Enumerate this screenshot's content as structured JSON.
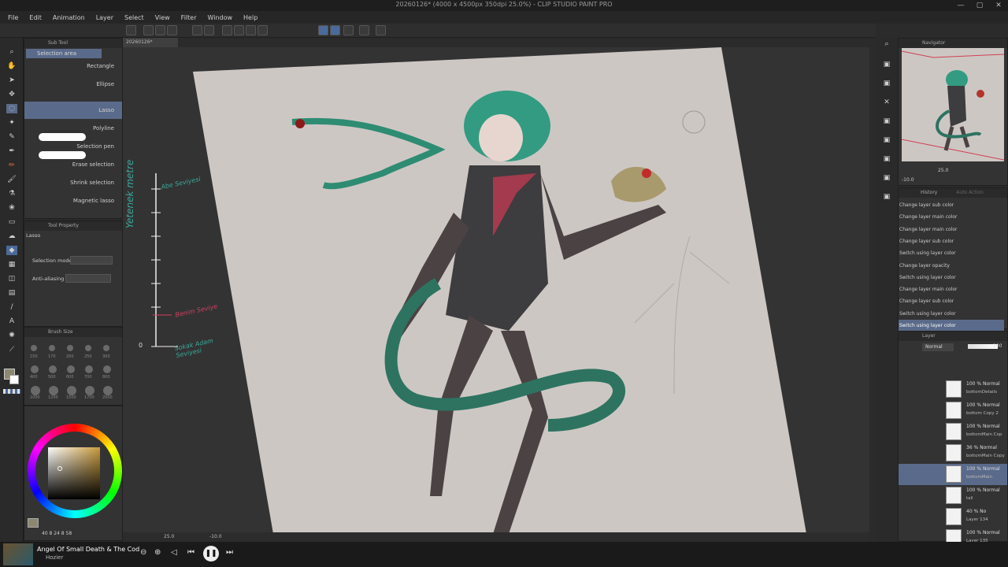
{
  "window": {
    "title": "20260126* (4000 x 4500px 350dpi 25.0%) - CLIP STUDIO PAINT PRO",
    "controls": [
      "—",
      "▢",
      "✕"
    ]
  },
  "menu": [
    "File",
    "Edit",
    "Animation",
    "Layer",
    "Select",
    "View",
    "Filter",
    "Window",
    "Help"
  ],
  "canvas_tab": "20260126*",
  "subtool": {
    "header": "Sub Tool",
    "group": "Selection area",
    "items": [
      {
        "label": "Rectangle"
      },
      {
        "label": "Ellipse"
      },
      {
        "label": "Lasso"
      },
      {
        "label": "Polyline"
      },
      {
        "label": "Selection pen"
      },
      {
        "label": "Erase selection"
      },
      {
        "label": "Shrink selection"
      },
      {
        "label": "Magnetic lasso"
      }
    ]
  },
  "tool_property": {
    "header": "Tool Property",
    "tool_name": "Lasso",
    "selection_mode_label": "Selection mode",
    "anti_aliasing_label": "Anti-aliasing"
  },
  "brush_size": {
    "header": "Brush Size",
    "values": [
      "150",
      "170",
      "200",
      "250",
      "300",
      "400",
      "500",
      "600",
      "700",
      "800",
      "1000",
      "1200",
      "1500",
      "1700",
      "2000"
    ]
  },
  "color": {
    "current_hsv": "40  8  24  8  58",
    "main_color": "#8c8770",
    "sub_color": "#ffffff"
  },
  "canvas_annotations": {
    "vertical_label": "Yetenek metre",
    "top_label": "Abe Seviyesi",
    "mid_label": "Benim Seviye",
    "bottom_label": "Sokak Adam Seviyesi",
    "zero": "0"
  },
  "statusbar": {
    "zoom": "25.0",
    "angle": "-10.0"
  },
  "navigator": {
    "header": "Navigator",
    "zoom": "25.0",
    "angle": "-10.0"
  },
  "history": {
    "tabs": [
      "History",
      "Auto Action"
    ],
    "items": [
      "Change layer sub color",
      "Change layer main color",
      "Change layer main color",
      "Change layer sub color",
      "Switch using layer color",
      "Change layer opacity",
      "Switch using layer color",
      "Change layer main color",
      "Change layer sub color",
      "Switch using layer color",
      "Switch using layer color"
    ],
    "selected_index": 10
  },
  "layers": {
    "header": "Layer",
    "blend_mode": "Normal",
    "opacity": "100",
    "rows": [
      {
        "pct": "100 % Normal",
        "name": "bottomDetails"
      },
      {
        "pct": "100 % Normal",
        "name": "bottom Copy 2"
      },
      {
        "pct": "100 % Normal",
        "name": "bottomMain Cop"
      },
      {
        "pct": "36 % Normal",
        "name": "bottomMain Copy"
      },
      {
        "pct": "100 % Normal",
        "name": "bottomMain"
      },
      {
        "pct": "100 % Normal",
        "name": "tail"
      },
      {
        "pct": "40 % No",
        "name": "Layer 134"
      },
      {
        "pct": "100 % Normal",
        "name": "Layer 135"
      }
    ],
    "selected_index": 4
  },
  "media": {
    "song": "Angel Of Small Death & The Cod",
    "artist": "Hozier"
  }
}
